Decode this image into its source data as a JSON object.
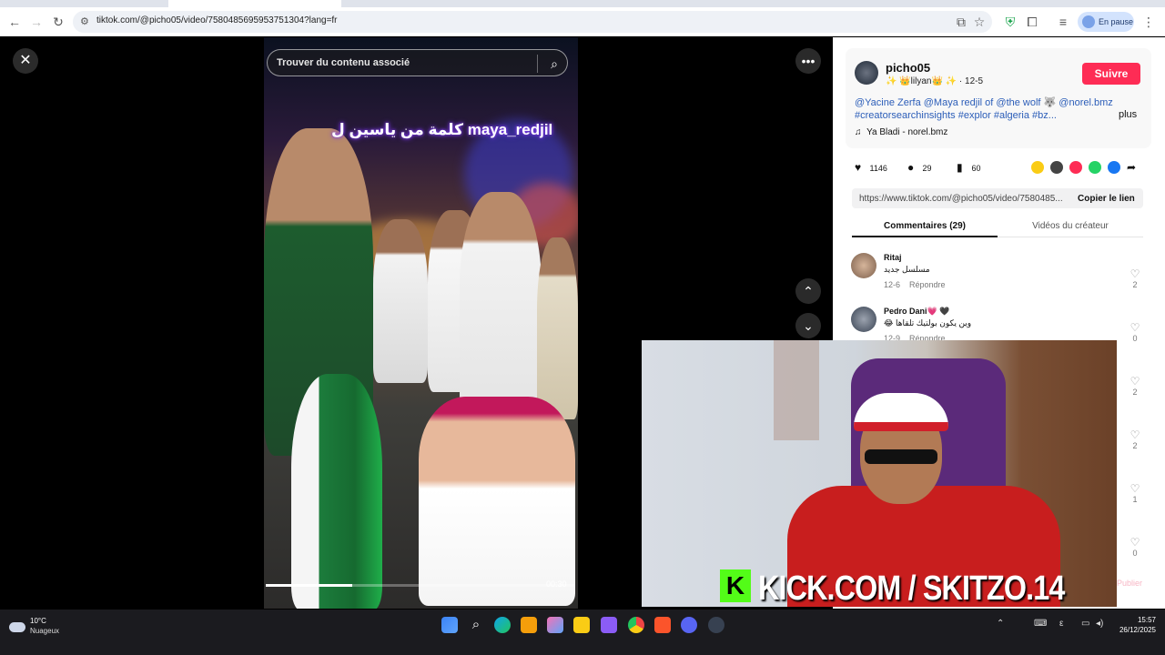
{
  "browser": {
    "url": "tiktok.com/@picho05/video/7580485695953751304?lang=fr",
    "profile_label": "En pause"
  },
  "video": {
    "search_placeholder": "Trouver du contenu associé",
    "caption_overlay": "كلمة من ياسين ل maya_redjil",
    "time": "00:30",
    "progress_fraction": 0.28
  },
  "creator": {
    "username": "picho05",
    "subtitle": "✨ 👑lilyan👑 ✨ · 12-5",
    "follow_label": "Suivre",
    "description": "@Yacine Zerfa @Maya redjil of @the wolf 🐺 @norel.bmz #creatorsearchinsights #explor #algeria #bz...",
    "more_label": "plus",
    "music": "Ya Bladi - norel.bmz"
  },
  "stats": {
    "likes": "1146",
    "comments": "29",
    "saves": "60"
  },
  "link": {
    "url": "https://www.tiktok.com/@picho05/video/7580485...",
    "copy_label": "Copier le lien"
  },
  "tabs": {
    "comments": "Commentaires (29)",
    "creator_videos": "Vidéos du créateur"
  },
  "comments": [
    {
      "name": "Ritaj",
      "text": "مسلسل جديد",
      "date": "12-6",
      "reply": "Répondre",
      "likes": "2"
    },
    {
      "name": "Pedro Dani💗 🖤",
      "text": "😂 وين يكون بولتيك تلقاها",
      "date": "12-9",
      "reply": "Répondre",
      "likes": "0"
    }
  ],
  "like_counts": [
    "2",
    "0",
    "2",
    "2",
    "1",
    "0"
  ],
  "publish_label": "Publier",
  "stream_overlay": {
    "kick_text": "KICK.COM / SKITZO.14"
  },
  "taskbar": {
    "temperature": "10°C",
    "weather": "Nuageux",
    "time": "15:57",
    "date": "26/12/2025"
  },
  "colors": {
    "follow": "#fe2c55",
    "link_blue": "#2b5db8",
    "kick_green": "#53fc18"
  }
}
